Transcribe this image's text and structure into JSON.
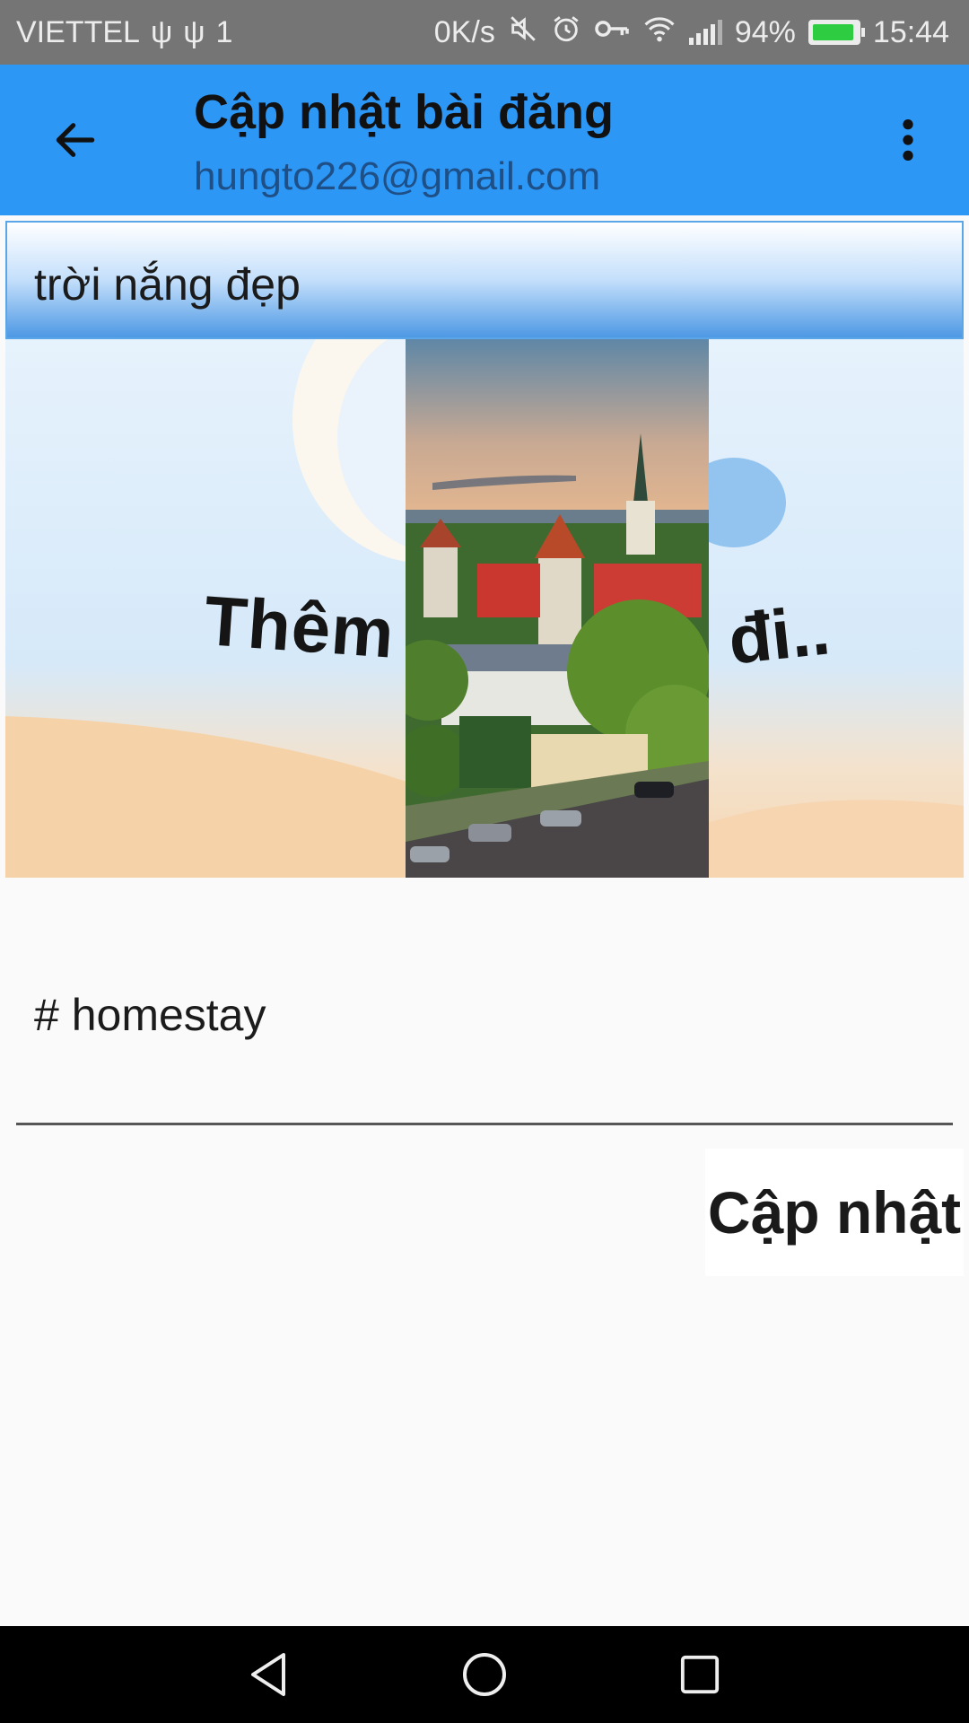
{
  "status_bar": {
    "carrier": "VIETTEL",
    "usb_glyph": "ψ",
    "data_glyph": "1",
    "net_speed": "0K/s",
    "battery_percent": "94%",
    "battery_level": 0.94,
    "time": "15:44",
    "icons": [
      "usb-icon",
      "mute-icon",
      "alarm-icon",
      "vpn-key-icon",
      "wifi-icon",
      "signal-icon",
      "battery-icon"
    ]
  },
  "app_bar": {
    "title": "Cập nhật bài đăng",
    "subtitle": "hungto226@gmail.com",
    "background": "#2d97f6",
    "icons": [
      "back-arrow-icon",
      "overflow-menu-icon"
    ]
  },
  "post": {
    "title_value": "trời nắng đẹp",
    "image_placeholder_left": "Thêm ả",
    "image_placeholder_right": "đi..",
    "hashtag_value": "# homestay"
  },
  "actions": {
    "update_label": "Cập nhật"
  },
  "nav_bar": {
    "icons": [
      "back-triangle-icon",
      "home-circle-icon",
      "recents-square-icon"
    ]
  },
  "colors": {
    "status_bar": "#757575",
    "accent": "#2d97f6",
    "battery": "#2ecc40"
  }
}
